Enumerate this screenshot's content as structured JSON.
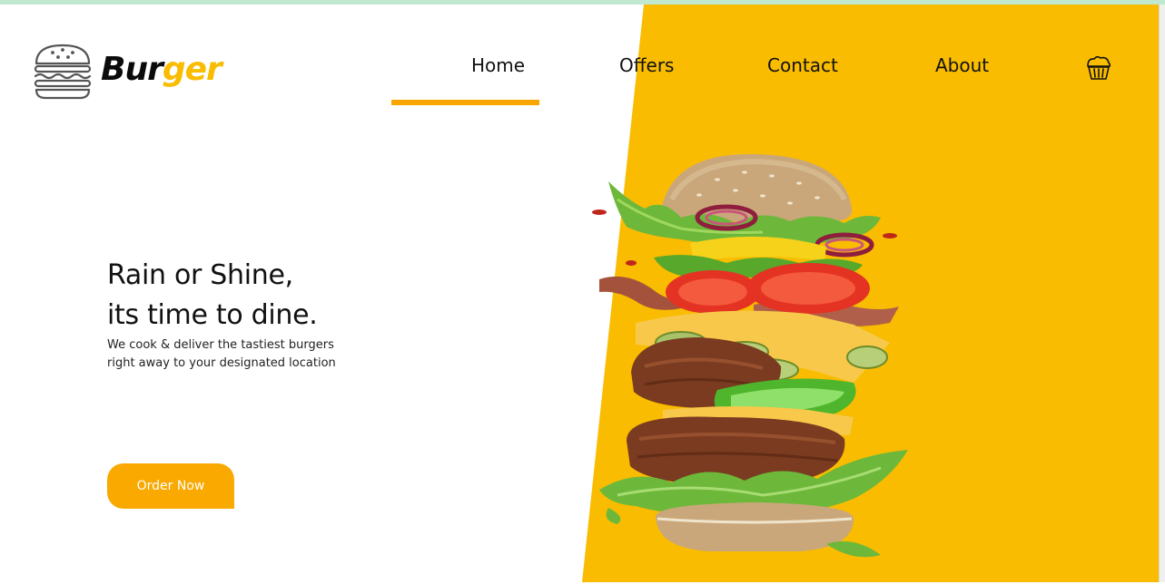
{
  "header": {
    "brand_part1": "Bur",
    "brand_part2": "ger",
    "logo_icon": "burger-outline-icon",
    "cart_icon": "cupcake-basket-icon"
  },
  "nav": {
    "items": [
      {
        "label": "Home",
        "active": true
      },
      {
        "label": "Offers"
      },
      {
        "label": "Contact"
      },
      {
        "label": "About"
      }
    ]
  },
  "hero": {
    "headline_line1": "Rain or Shine,",
    "headline_line2": "its time to dine.",
    "sub_line1": "We cook & deliver the tastiest burgers",
    "sub_line2": "right away to your designated location",
    "cta_label": "Order Now",
    "image": "exploded-burger-image"
  },
  "colors": {
    "accent": "#f9bc00",
    "button": "#f9a900",
    "text": "#111111"
  }
}
